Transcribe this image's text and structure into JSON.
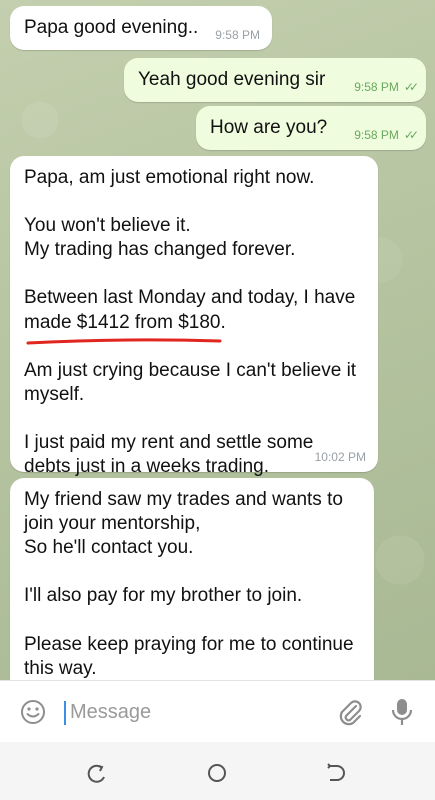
{
  "messages": [
    {
      "direction": "in",
      "lines": [
        "Papa good evening.."
      ],
      "time": "9:58 PM"
    },
    {
      "direction": "out",
      "lines": [
        "Yeah good evening sir"
      ],
      "time": "9:58 PM",
      "read": true
    },
    {
      "direction": "out",
      "lines": [
        "How are you?"
      ],
      "time": "9:58 PM",
      "read": true
    },
    {
      "direction": "in",
      "paragraphs": [
        [
          "Papa, am just emotional right now."
        ],
        [
          "You won't believe it.",
          "My trading has changed forever."
        ],
        [
          "Between last Monday and today, I have",
          "made $1412 from $180."
        ],
        [
          "Am just crying because I can't believe it",
          "myself."
        ],
        [
          "I just paid my rent and settle some",
          "debts just in a weeks trading."
        ]
      ],
      "time": "10:02 PM"
    },
    {
      "direction": "in",
      "paragraphs": [
        [
          "My friend saw my trades and wants to",
          "join your mentorship,",
          "So he'll contact you."
        ],
        [
          "I'll also pay for my brother to join."
        ],
        [
          "Please keep praying for me to continue",
          "this way."
        ]
      ]
    }
  ],
  "composer": {
    "placeholder": "Message"
  },
  "icons": {
    "emoji": "emoji-icon",
    "attach": "paperclip-icon",
    "mic": "microphone-icon",
    "nav_recent": "recent-apps-icon",
    "nav_home": "home-icon",
    "nav_back": "back-icon"
  },
  "colors": {
    "incoming_bubble": "#ffffff",
    "outgoing_bubble": "#effdde",
    "read_check": "#6aa85c",
    "highlight_underline": "#e0261f",
    "caret": "#3a8ee6"
  }
}
